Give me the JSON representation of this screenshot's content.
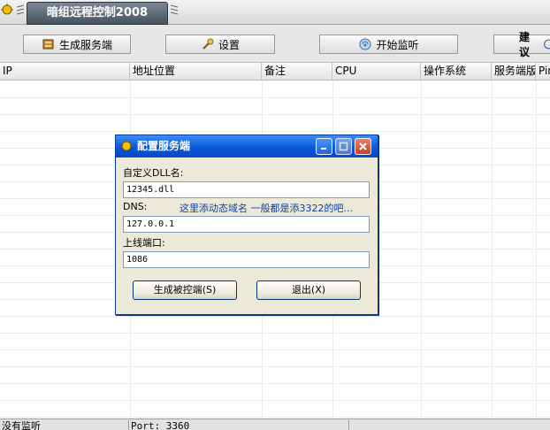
{
  "app": {
    "title": "暗组远程控制2008"
  },
  "toolbar": {
    "build_label": "生成服务端",
    "settings_label": "设置",
    "monitor_label": "开始监听",
    "suggest_label": "建议"
  },
  "table": {
    "columns": [
      "IP",
      "地址位置",
      "备注",
      "CPU",
      "操作系统",
      "服务端版",
      "Pin"
    ]
  },
  "statusbar": {
    "status": "没有监听",
    "port": "Port: 3360",
    "extra": ""
  },
  "dialog": {
    "title": "配置服务端",
    "dll_label": "自定义DLL名:",
    "dll_value": "12345.dll",
    "dns_label": "DNS:",
    "dns_hint": "这里添动态域名 一般都是添3322的吧...",
    "dns_value": "127.0.0.1",
    "port_label": "上线端口:",
    "port_value": "1086",
    "generate_button": "生成被控端(S)",
    "exit_button": "退出(X)"
  }
}
